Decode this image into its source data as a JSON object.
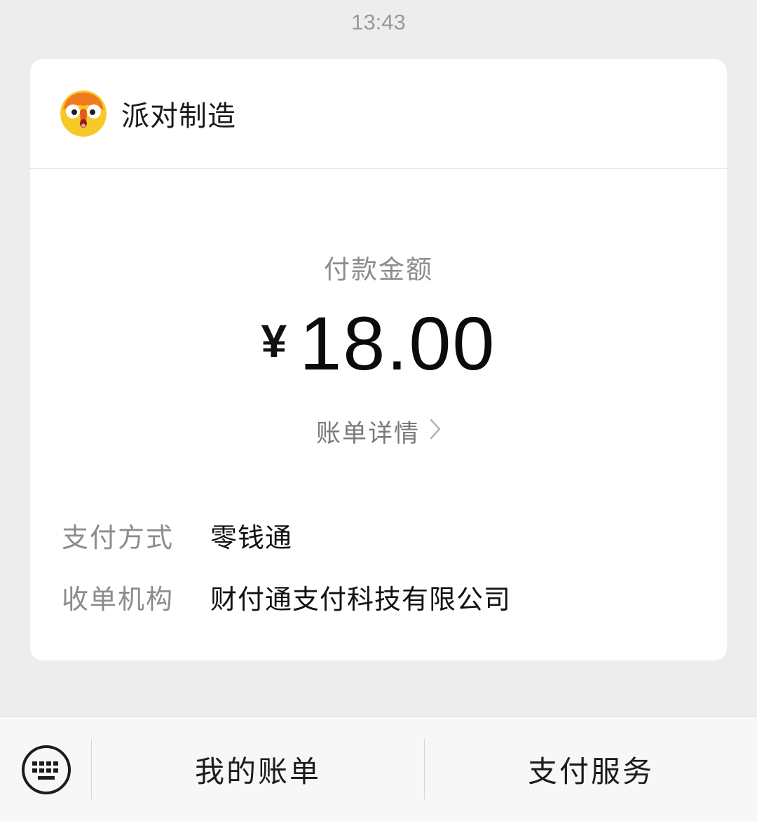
{
  "timestamp": "13:43",
  "card": {
    "merchant_name": "派对制造",
    "amount_label": "付款金额",
    "currency_symbol": "¥",
    "amount": "18.00",
    "bill_detail_label": "账单详情",
    "rows": [
      {
        "key": "支付方式",
        "value": "零钱通"
      },
      {
        "key": "收单机构",
        "value": "财付通支付科技有限公司"
      }
    ]
  },
  "bottom_bar": {
    "keyboard_icon": "keyboard-icon",
    "menu": [
      {
        "label": "我的账单"
      },
      {
        "label": "支付服务"
      }
    ]
  },
  "colors": {
    "background": "#ededed",
    "card": "#ffffff",
    "muted_text": "#8c8c8c"
  }
}
